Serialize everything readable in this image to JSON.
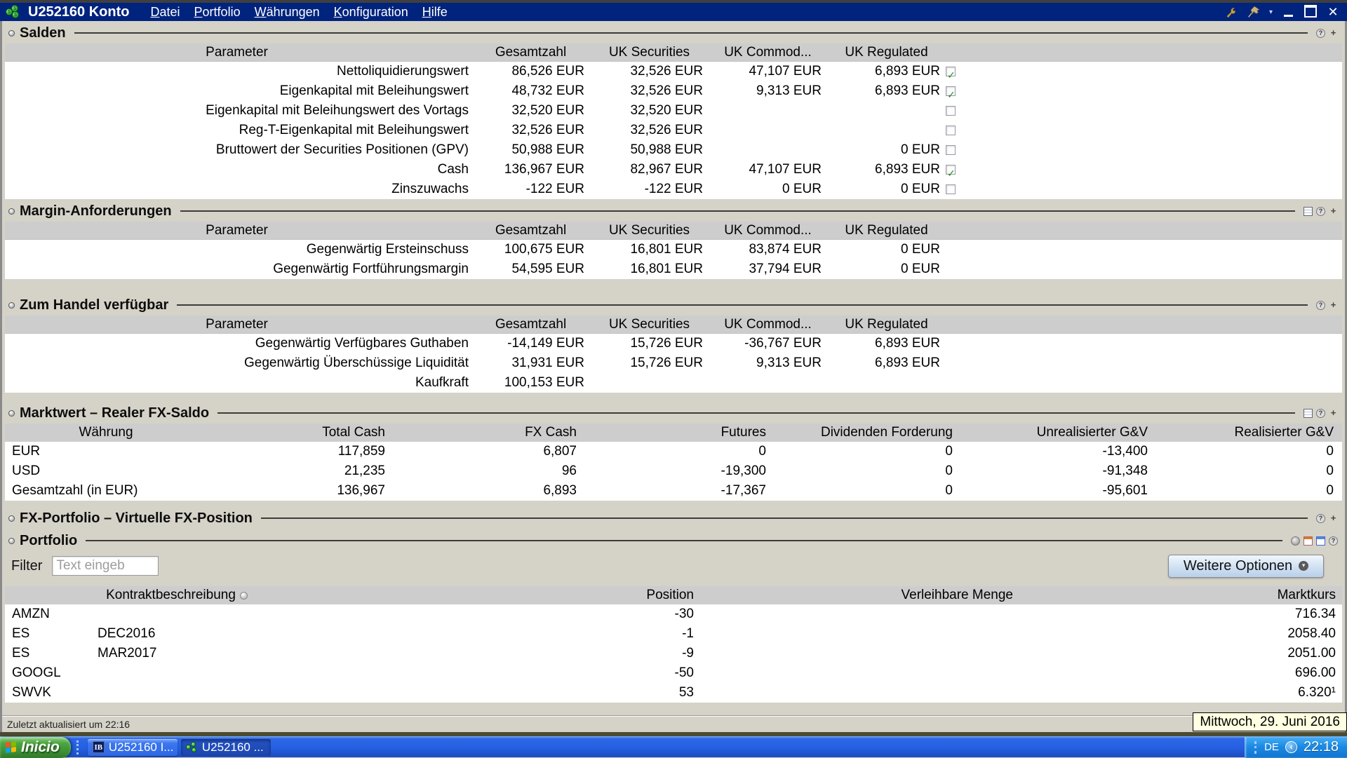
{
  "window": {
    "title": "U252160 Konto",
    "menus": [
      {
        "u": "D",
        "rest": "atei"
      },
      {
        "u": "P",
        "rest": "ortfolio"
      },
      {
        "u": "W",
        "rest": "ährungen"
      },
      {
        "u": "K",
        "rest": "onfiguration"
      },
      {
        "u": "H",
        "rest": "ilfe"
      }
    ]
  },
  "account_columns": {
    "param": "Parameter",
    "total": "Gesamtzahl",
    "sec": "UK Securities",
    "com": "UK Commod...",
    "reg": "UK Regulated"
  },
  "salden": {
    "title": "Salden",
    "rows": [
      {
        "label": "Nettoliquidierungswert",
        "total": "86,526 EUR",
        "sec": "32,526 EUR",
        "com": "47,107 EUR",
        "reg": "6,893 EUR",
        "checked": true
      },
      {
        "label": "Eigenkapital mit Beleihungswert",
        "total": "48,732 EUR",
        "sec": "32,526 EUR",
        "com": "9,313 EUR",
        "reg": "6,893 EUR",
        "checked": true
      },
      {
        "label": "Eigenkapital mit Beleihungswert des Vortags",
        "total": "32,520 EUR",
        "sec": "32,520 EUR",
        "com": "",
        "reg": "",
        "checked": false
      },
      {
        "label": "Reg-T-Eigenkapital mit Beleihungswert",
        "total": "32,526 EUR",
        "sec": "32,526 EUR",
        "com": "",
        "reg": "",
        "checked": false
      },
      {
        "label": "Bruttowert der Securities Positionen (GPV)",
        "total": "50,988 EUR",
        "sec": "50,988 EUR",
        "com": "",
        "reg": "0 EUR",
        "checked": false
      },
      {
        "label": "Cash",
        "total": "136,967 EUR",
        "sec": "82,967 EUR",
        "com": "47,107 EUR",
        "reg": "6,893 EUR",
        "checked": true
      },
      {
        "label": "Zinszuwachs",
        "total": "-122 EUR",
        "sec": "-122 EUR",
        "com": "0 EUR",
        "reg": "0 EUR",
        "checked": false
      }
    ]
  },
  "margin": {
    "title": "Margin-Anforderungen",
    "rows": [
      {
        "label": "Gegenwärtig Ersteinschuss",
        "total": "100,675 EUR",
        "sec": "16,801 EUR",
        "com": "83,874 EUR",
        "reg": "0 EUR"
      },
      {
        "label": "Gegenwärtig Fortführungsmargin",
        "total": "54,595 EUR",
        "sec": "16,801 EUR",
        "com": "37,794 EUR",
        "reg": "0 EUR"
      }
    ]
  },
  "handel": {
    "title": "Zum Handel verfügbar",
    "rows": [
      {
        "label": "Gegenwärtig Verfügbares Guthaben",
        "total": "-14,149 EUR",
        "sec": "15,726 EUR",
        "com": "-36,767 EUR",
        "reg": "6,893 EUR"
      },
      {
        "label": "Gegenwärtig Überschüssige Liquidität",
        "total": "31,931 EUR",
        "sec": "15,726 EUR",
        "com": "9,313 EUR",
        "reg": "6,893 EUR"
      },
      {
        "label": "Kaufkraft",
        "total": "100,153 EUR",
        "sec": "",
        "com": "",
        "reg": ""
      }
    ]
  },
  "marktwert": {
    "title": "Marktwert – Realer FX-Saldo",
    "columns": {
      "currency": "Währung",
      "total_cash": "Total Cash",
      "fx_cash": "FX Cash",
      "futures": "Futures",
      "dividends": "Dividenden Forderung",
      "unrealized": "Unrealisierter G&V",
      "realized": "Realisierter G&V"
    },
    "rows": [
      {
        "currency": "EUR",
        "total_cash": "117,859",
        "fx_cash": "6,807",
        "futures": "0",
        "dividends": "0",
        "unrealized": "-13,400",
        "realized": "0"
      },
      {
        "currency": "USD",
        "total_cash": "21,235",
        "fx_cash": "96",
        "futures": "-19,300",
        "dividends": "0",
        "unrealized": "-91,348",
        "realized": "0"
      },
      {
        "currency": "Gesamtzahl (in EUR)",
        "total_cash": "136,967",
        "fx_cash": "6,893",
        "futures": "-17,367",
        "dividends": "0",
        "unrealized": "-95,601",
        "realized": "0"
      }
    ]
  },
  "fx_portfolio": {
    "title": "FX-Portfolio – Virtuelle FX-Position"
  },
  "portfolio": {
    "title": "Portfolio",
    "filter_label": "Filter",
    "filter_placeholder": "Text eingeb",
    "more_options_label": "Weitere Optionen",
    "columns": {
      "contract": "Kontraktbeschreibung",
      "position": "Position",
      "lendable": "Verleihbare Menge",
      "price": "Marktkurs"
    },
    "rows": [
      {
        "symbol": "AMZN",
        "month": "",
        "position": "-30",
        "lendable": "",
        "price": "716.34"
      },
      {
        "symbol": "ES",
        "month": "DEC2016",
        "position": "-1",
        "lendable": "",
        "price": "2058.40"
      },
      {
        "symbol": "ES",
        "month": "MAR2017",
        "position": "-9",
        "lendable": "",
        "price": "2051.00"
      },
      {
        "symbol": "GOOGL",
        "month": "",
        "position": "-50",
        "lendable": "",
        "price": "696.00"
      },
      {
        "symbol": "SWVK",
        "month": "",
        "position": "53",
        "lendable": "",
        "price": "6.320¹"
      }
    ]
  },
  "status_bar": {
    "text": "Zuletzt aktualisiert um 22:16"
  },
  "tooltip": {
    "date": "Mittwoch, 29. Juni 2016"
  },
  "taskbar": {
    "start_label": "Inicio",
    "tasks": [
      {
        "label": "U252160 I..."
      },
      {
        "label": "U252160 ..."
      }
    ],
    "language": "DE",
    "clock": "22:18"
  }
}
